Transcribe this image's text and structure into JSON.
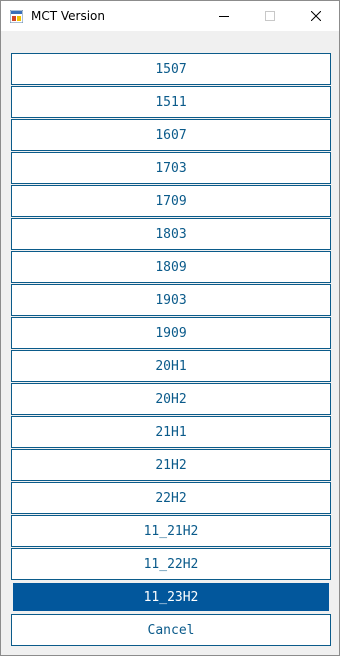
{
  "window": {
    "title": "MCT Version"
  },
  "buttons": [
    {
      "label": "1507"
    },
    {
      "label": "1511"
    },
    {
      "label": "1607"
    },
    {
      "label": "1703"
    },
    {
      "label": "1709"
    },
    {
      "label": "1803"
    },
    {
      "label": "1809"
    },
    {
      "label": "1903"
    },
    {
      "label": "1909"
    },
    {
      "label": "20H1"
    },
    {
      "label": "20H2"
    },
    {
      "label": "21H1"
    },
    {
      "label": "21H2"
    },
    {
      "label": "22H2"
    },
    {
      "label": "11_21H2"
    },
    {
      "label": "11_22H2"
    },
    {
      "label": "11_23H2",
      "selected": true
    },
    {
      "label": "Cancel"
    }
  ],
  "colors": {
    "accent": "#02579c",
    "border": "#0b5b8a",
    "text": "#0a5a8a"
  }
}
